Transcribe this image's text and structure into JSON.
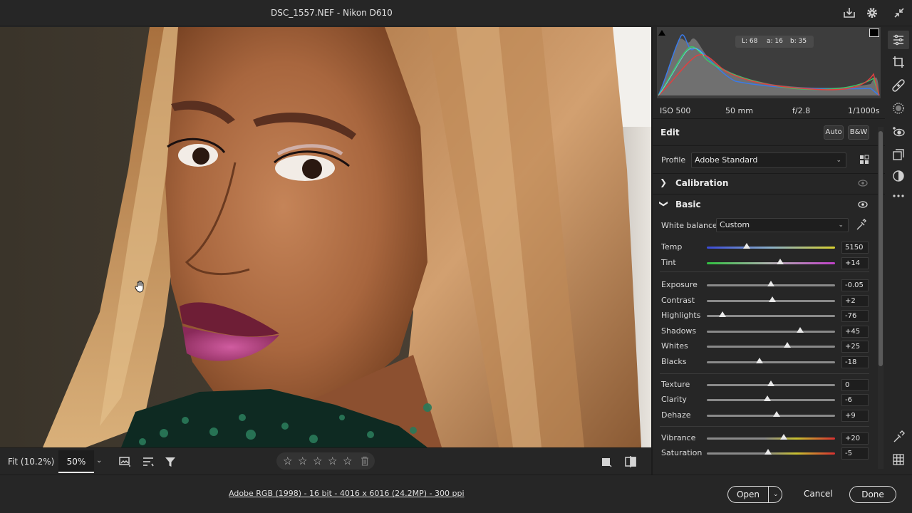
{
  "window": {
    "title": "DSC_1557.NEF  -  Nikon D610"
  },
  "histogram": {
    "lab": {
      "l": "L: 68",
      "a": "a: 16",
      "b": "b: 35"
    }
  },
  "exif": {
    "iso": "ISO 500",
    "focal": "50 mm",
    "aperture": "f/2.8",
    "shutter": "1/1000s"
  },
  "edit": {
    "title": "Edit",
    "auto_label": "Auto",
    "bw_label": "B&W",
    "profile_label": "Profile",
    "profile_value": "Adobe Standard"
  },
  "sections": {
    "calibration": "Calibration",
    "basic": "Basic"
  },
  "white_balance": {
    "label": "White balance",
    "value": "Custom"
  },
  "sliders": [
    {
      "id": "temp",
      "label": "Temp",
      "value": "5150",
      "pos": 0.31,
      "track": "temp"
    },
    {
      "id": "tint",
      "label": "Tint",
      "value": "+14",
      "pos": 0.57,
      "track": "tint"
    },
    {
      "id": "exposure",
      "label": "Exposure",
      "value": "-0.05",
      "pos": 0.5,
      "track": "gray"
    },
    {
      "id": "contrast",
      "label": "Contrast",
      "value": "+2",
      "pos": 0.51,
      "track": "gray"
    },
    {
      "id": "highlights",
      "label": "Highlights",
      "value": "-76",
      "pos": 0.12,
      "track": "gray"
    },
    {
      "id": "shadows",
      "label": "Shadows",
      "value": "+45",
      "pos": 0.725,
      "track": "gray"
    },
    {
      "id": "whites",
      "label": "Whites",
      "value": "+25",
      "pos": 0.625,
      "track": "gray"
    },
    {
      "id": "blacks",
      "label": "Blacks",
      "value": "-18",
      "pos": 0.41,
      "track": "gray"
    },
    {
      "id": "texture",
      "label": "Texture",
      "value": "0",
      "pos": 0.5,
      "track": "gray"
    },
    {
      "id": "clarity",
      "label": "Clarity",
      "value": "-6",
      "pos": 0.47,
      "track": "gray"
    },
    {
      "id": "dehaze",
      "label": "Dehaze",
      "value": "+9",
      "pos": 0.545,
      "track": "gray"
    },
    {
      "id": "vibrance",
      "label": "Vibrance",
      "value": "+20",
      "pos": 0.6,
      "track": "color"
    },
    {
      "id": "saturation",
      "label": "Saturation",
      "value": "-5",
      "pos": 0.475,
      "track": "color"
    }
  ],
  "viewbar": {
    "fit_label": "Fit (10.2%)",
    "zoom_label": "50%"
  },
  "footer": {
    "info": "Adobe RGB (1998) - 16 bit - 4016 x 6016 (24.2MP) - 300 ppi",
    "open_label": "Open",
    "cancel_label": "Cancel",
    "done_label": "Done"
  },
  "colors": {
    "panel_bg": "#262626",
    "histogram_bg": "#3d3d3d",
    "slider_thumb": "#e9e9e9"
  }
}
